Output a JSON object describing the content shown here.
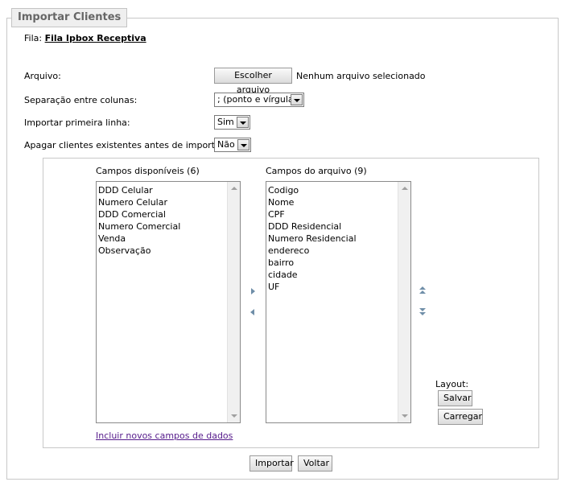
{
  "form": {
    "legend": "Importar Clientes",
    "fila_label": "Fila:",
    "fila_value": "Fila Ipbox Receptiva",
    "arquivo_label": "Arquivo:",
    "file_button": "Escolher arquivo",
    "file_status": "Nenhum arquivo selecionado",
    "separacao_label": "Separação entre colunas:",
    "separacao_value": "; (ponto e vírgula)",
    "primeira_linha_label": "Importar primeira linha:",
    "primeira_linha_value": "Sim",
    "apagar_label": "Apagar clientes existentes antes de importar:",
    "apagar_value": "Não"
  },
  "fields": {
    "disponiveis_title": "Campos disponíveis (6)",
    "disponiveis": [
      "DDD Celular",
      "Numero Celular",
      "DDD Comercial",
      "Numero Comercial",
      "Venda",
      "Observação"
    ],
    "arquivo_title": "Campos do arquivo (9)",
    "arquivo": [
      "Codigo",
      "Nome",
      "CPF",
      "DDD Residencial",
      "Numero Residencial",
      "endereco",
      "bairro",
      "cidade",
      "UF"
    ],
    "incluir_link": "Incluir novos campos de dados"
  },
  "layout_panel": {
    "label": "Layout:",
    "salvar": "Salvar",
    "carregar": "Carregar"
  },
  "actions": {
    "importar": "Importar",
    "voltar": "Voltar"
  }
}
